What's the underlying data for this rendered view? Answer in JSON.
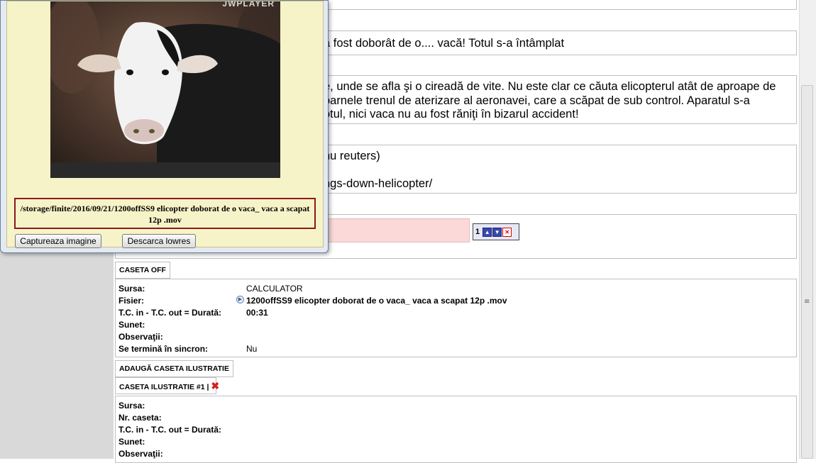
{
  "article": {
    "title_fragment": "a fost doborât de o.... vacă! Totul s-a întâmplat",
    "body_lines": [
      "e, unde se afla şi o cireadă de vite. Nu este clar ce căuta elicopterul atât de aproape de",
      "oarnele trenul de aterizare al aeronavei, care a scăpat de sub control. Aparatul s-a",
      "otul, nici vaca nu au fost răniţi în bizarul accident!"
    ],
    "source_line1": "nu reuters)",
    "source_line2": "ngs-down-helicopter/"
  },
  "order_control": {
    "number": "1",
    "up_icon": "arrow-up-icon",
    "down_icon": "arrow-down-icon",
    "delete_icon": "delete-icon"
  },
  "caseta_off": {
    "tab_label": "CASETA OFF",
    "fields": [
      {
        "label": "Sursa:",
        "value": "CALCULATOR"
      },
      {
        "label": "Fisier:",
        "value": "1200offSS9 elicopter doborat de o vaca_ vaca a scapat 12p .mov"
      },
      {
        "label": "T.C. in - T.C. out = Durată:",
        "value": "00:31"
      },
      {
        "label": "Sunet:",
        "value": ""
      },
      {
        "label": "Observaţii:",
        "value": ""
      },
      {
        "label": "Se termină în sincron:",
        "value": "Nu"
      }
    ]
  },
  "add_illustration_label": "ADAUGĂ CASETA ILUSTRATIE",
  "caseta_ilustratie": {
    "tab_label": "CASETA ILUSTRATIE #1",
    "separator": "|",
    "fields": [
      {
        "label": "Sursa:"
      },
      {
        "label": "Nr. caseta:"
      },
      {
        "label": "T.C. in - T.C. out = Durată:"
      },
      {
        "label": "Sunet:"
      },
      {
        "label": "Observaţii:"
      }
    ]
  },
  "player_popup": {
    "logo_text": "JWPLAYER",
    "file_path": "/storage/finite/2016/09/21/1200offSS9 elicopter doborat de o vaca_ vaca a scapat 12p .mov",
    "capture_button": "Captureaza imagine",
    "download_button": "Descarca lowres"
  },
  "colors": {
    "accent_red": "#8b1a1a",
    "popup_bg": "#f7f3c8",
    "input_error": "#fbd9d9"
  }
}
